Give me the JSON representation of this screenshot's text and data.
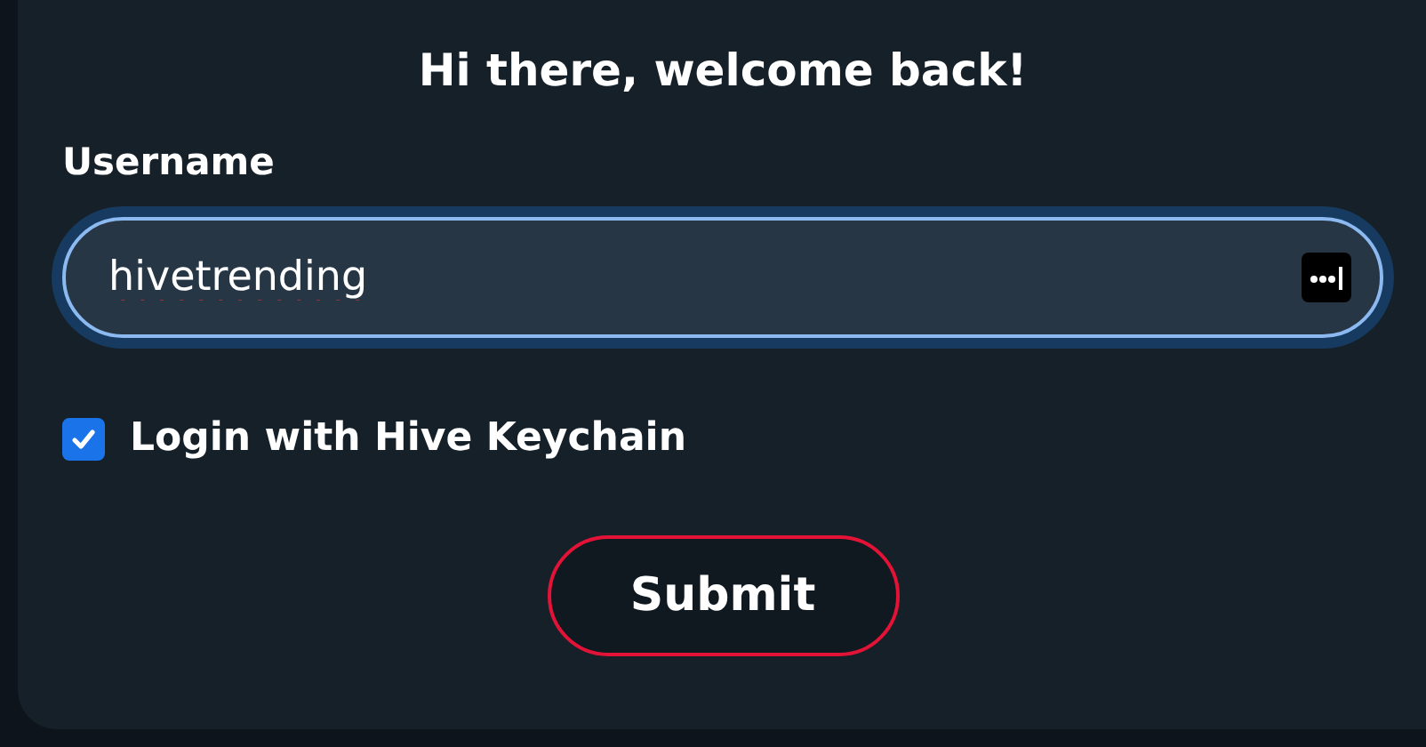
{
  "title": "Hi there, welcome back!",
  "username": {
    "label": "Username",
    "value": "hivetrending"
  },
  "keychain": {
    "label": "Login with Hive Keychain",
    "checked": true
  },
  "submit": {
    "label": "Submit"
  }
}
